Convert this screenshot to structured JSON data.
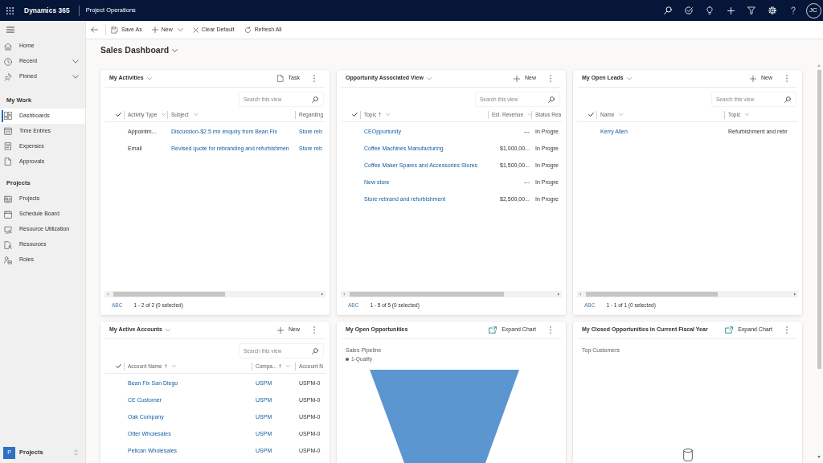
{
  "top_bar": {
    "app_name": "Dynamics 365",
    "area_title": "Project Operations",
    "avatar": {
      "initials": "JC"
    }
  },
  "sidebar": {
    "top_items": [
      {
        "label": "Home",
        "kind": "link"
      },
      {
        "label": "Recent",
        "kind": "expander",
        "expanded": false
      },
      {
        "label": "Pinned",
        "kind": "expander",
        "expanded": false
      }
    ],
    "sections": [
      {
        "title": "My Work",
        "items": [
          {
            "label": "Dashboards",
            "selected": true
          },
          {
            "label": "Time Entries",
            "selected": false
          },
          {
            "label": "Expenses",
            "selected": false
          },
          {
            "label": "Approvals",
            "selected": false
          }
        ]
      },
      {
        "title": "Projects",
        "items": [
          {
            "label": "Projects",
            "selected": false
          },
          {
            "label": "Schedule Board",
            "selected": false
          },
          {
            "label": "Resource Utilization",
            "selected": false
          },
          {
            "label": "Resources",
            "selected": false
          },
          {
            "label": "Roles",
            "selected": false
          }
        ]
      }
    ],
    "area_switcher": {
      "badge": "P",
      "label": "Projects"
    }
  },
  "command_bar": {
    "buttons": [
      {
        "label": "Save As",
        "kind": "button"
      },
      {
        "label": "New",
        "kind": "split"
      },
      {
        "label": "Clear Default",
        "kind": "button"
      },
      {
        "label": "Refresh All",
        "kind": "button"
      }
    ]
  },
  "page_title": "Sales Dashboard",
  "cards": [
    {
      "kind": "grid",
      "title": "My Activities",
      "action": {
        "label": "Task",
        "kind": "task"
      },
      "search": {
        "placeholder": "Search this view"
      },
      "columns": [
        {
          "label": "Activity Type",
          "kind": "text",
          "sorted": false,
          "menu": true
        },
        {
          "label": "Subject",
          "kind": "link",
          "sorted": false,
          "menu": true
        },
        {
          "label": "Regarding",
          "kind": "link",
          "sorted": false,
          "menu": false
        }
      ],
      "rows": [
        [
          "Appointm...",
          "Discussion-$2.5 mn enquiry from Bean Fix",
          "Store reb"
        ],
        [
          "Email",
          "Revised quote for rebranding and refurbishmen",
          "Store reb"
        ]
      ],
      "footer": {
        "jump_bar": "ABC",
        "count": "1 - 2 of 2 (0 selected)"
      }
    },
    {
      "kind": "grid",
      "title": "Opportunity Associated View",
      "action": {
        "label": "New",
        "kind": "new"
      },
      "search": {
        "placeholder": "Search this view"
      },
      "columns": [
        {
          "label": "Topic",
          "kind": "link",
          "sorted": true,
          "menu": true
        },
        {
          "label": "Est. Revenue",
          "kind": "currency",
          "sorted": false,
          "menu": true
        },
        {
          "label": "Status Rea",
          "kind": "text",
          "sorted": false,
          "menu": false
        }
      ],
      "rows": [
        [
          "CEOppurtunity",
          "---",
          "In Progre"
        ],
        [
          "Coffee Machines Manufacturing",
          "$1,000,00...",
          "In Progre"
        ],
        [
          "Coffee Maker Spares and Accessories Stores",
          "$1,500,00...",
          "In Progre"
        ],
        [
          "New store",
          "---",
          "In Progre"
        ],
        [
          "Store rebrand and refurbishment",
          "$2,500,00...",
          "In Progre"
        ]
      ],
      "footer": {
        "jump_bar": "ABC",
        "count": "1 - 5 of 5 (0 selected)"
      }
    },
    {
      "kind": "grid",
      "title": "My Open Leads",
      "action": {
        "label": "New",
        "kind": "new"
      },
      "search": {
        "placeholder": "Search this view"
      },
      "columns": [
        {
          "label": "Name",
          "kind": "link",
          "sorted": false,
          "menu": true
        },
        {
          "label": "Topic",
          "kind": "text",
          "sorted": false,
          "menu": true
        }
      ],
      "rows": [
        [
          "Kerry Allen",
          "Refurbishment and rebr"
        ]
      ],
      "footer": {
        "jump_bar": "ABC",
        "count": "1 - 1 of 1 (0 selected)"
      }
    },
    {
      "kind": "grid",
      "title": "My Active Accounts",
      "action": {
        "label": "New",
        "kind": "new"
      },
      "search": {
        "placeholder": "Search this view"
      },
      "columns": [
        {
          "label": "Account Name",
          "kind": "link",
          "sorted": true,
          "menu": true
        },
        {
          "label": "Compa...",
          "kind": "link",
          "sorted": true,
          "menu": true
        },
        {
          "label": "Account N",
          "kind": "text",
          "sorted": false,
          "menu": false
        }
      ],
      "rows": [
        [
          "Bean Fix San Diego",
          "USPM",
          "USPM-0"
        ],
        [
          "CE Customer",
          "USPM",
          "USPM-0"
        ],
        [
          "Oak Company",
          "USPM",
          "USPM-0"
        ],
        [
          "Otter Wholesales",
          "USPM",
          "USPM-0"
        ],
        [
          "Pelican Wholesales",
          "USPM",
          "USPM-0"
        ]
      ]
    },
    {
      "kind": "chart",
      "title": "My Open Opportunities",
      "action": {
        "label": "Expand Chart",
        "kind": "expand"
      },
      "chart": {
        "kind": "funnel",
        "title": "Sales Pipeline",
        "legend": [
          {
            "label": "1-Qualify"
          }
        ]
      }
    },
    {
      "kind": "chart",
      "title": "My Closed Opportunities in Current Fiscal Year",
      "action": {
        "label": "Expand Chart",
        "kind": "expand"
      },
      "chart": {
        "kind": "empty",
        "title": "Top Customers"
      }
    }
  ]
}
